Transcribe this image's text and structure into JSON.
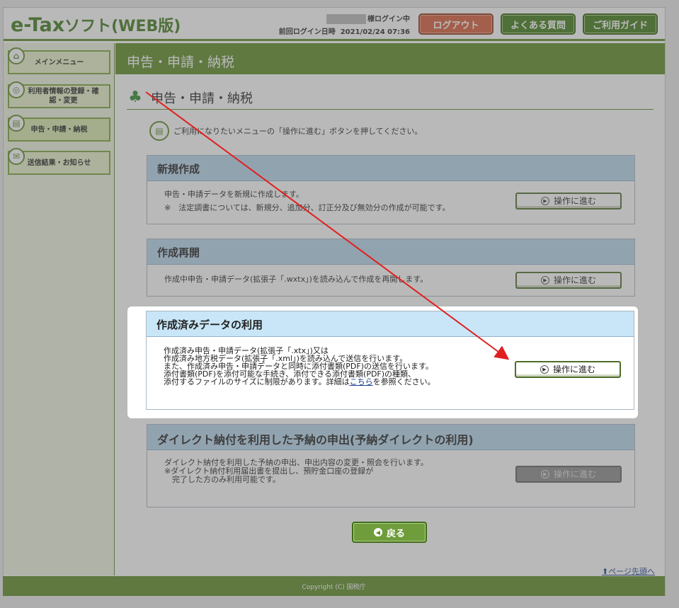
{
  "header": {
    "logo_main": "e-Tax",
    "logo_kana": "ソフト(WEB版)",
    "login_status": "様ログイン中",
    "last_login_label": "前回ログイン日時",
    "last_login_value": "2021/02/24 07:36",
    "logout_label": "ログアウト",
    "faq_label": "よくある質問",
    "guide_label": "ご利用ガイド"
  },
  "sidebar": {
    "items": [
      {
        "label": "メインメニュー"
      },
      {
        "label": "利用者情報の登録・確認・変更"
      },
      {
        "label": "申告・申請・納税"
      },
      {
        "label": "送信結果・お知らせ"
      }
    ]
  },
  "main": {
    "header_title": "申告・申請・納税",
    "section_title": "申告・申請・納税",
    "instruction": "ご利用になりたいメニューの「操作に進む」ボタンを押してください。",
    "panels": [
      {
        "title": "新規作成",
        "lines": [
          "申告・申請データを新規に作成します。",
          "※　法定調書については、新規分、追加分、訂正分及び無効分の作成が可能です。"
        ],
        "button": "操作に進む"
      },
      {
        "title": "作成再開",
        "lines": [
          "作成中申告・申請データ(拡張子「.wxtx」)を読み込んで作成を再開します。"
        ],
        "button": "操作に進む"
      },
      {
        "title": "作成済みデータの利用",
        "lines": [
          "作成済み申告・申請データ(拡張子「.xtx」)又は",
          "作成済み地方税データ(拡張子「.xml」)を読み込んで送信を行います。",
          "また、作成済み申告・申請データと同時に添付書類(PDF)の送信を行います。",
          "添付書類(PDF)を添付可能な手続き、添付できる添付書類(PDF)の種類、",
          "添付するファイルのサイズに制限があります。詳細は"
        ],
        "link": "こちら",
        "link_after": "を参照ください。",
        "button": "操作に進む"
      },
      {
        "title": "ダイレクト納付を利用した予納の申出(予納ダイレクトの利用)",
        "lines": [
          "ダイレクト納付を利用した予納の申出、申出内容の変更・照会を行います。",
          "※ダイレクト納付利用届出書を提出し、預貯金口座の登録が",
          "　完了した方のみ利用可能です。"
        ],
        "button": "操作に進む"
      }
    ],
    "back_button": "戻る",
    "page_top_link": "ページ先頭へ"
  },
  "footer": {
    "copyright": "Copyright (C) 国税庁"
  },
  "colors": {
    "brand_green": "#5b8b26",
    "panel_blue": "#b8d7ee",
    "logout_orange": "#d85c37",
    "annotation_arrow": "#e02020"
  }
}
